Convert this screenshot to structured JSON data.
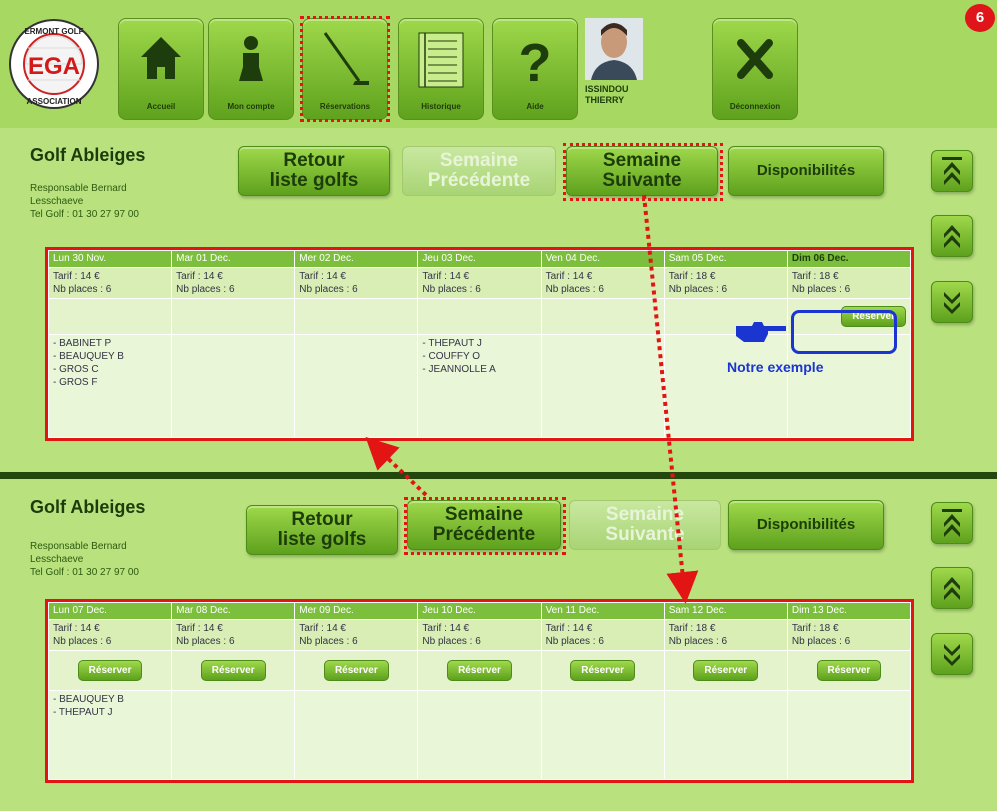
{
  "brand": {
    "logo_text": "EGA",
    "ring_text": "ERMONT GOLF ASSOCIATION"
  },
  "nav": {
    "items": [
      {
        "label": "Accueil",
        "icon": "home-icon"
      },
      {
        "label": "Mon compte",
        "icon": "person-icon"
      },
      {
        "label": "Réservations",
        "icon": "golf-club-icon"
      },
      {
        "label": "Historique",
        "icon": "list-icon"
      },
      {
        "label": "Aide",
        "icon": "question-icon"
      },
      {
        "label": "Déconnexion",
        "icon": "close-icon"
      }
    ],
    "user_line1": "ISSINDOU",
    "user_line2": "THIERRY",
    "badge": "6"
  },
  "golf": {
    "name": "Golf Ableiges",
    "responsable": "Responsable Bernard Lesschaeve",
    "tel": "Tel Golf : 01 30 27 97 00"
  },
  "buttons": {
    "retour_line1": "Retour",
    "retour_line2": "liste golfs",
    "prev_line1": "Semaine",
    "prev_line2": "Précédente",
    "next_line1": "Semaine",
    "next_line2": "Suivante",
    "dispo": "Disponibilités",
    "reserver": "Réserver"
  },
  "annotation": {
    "exemple": "Notre exemple"
  },
  "week1": {
    "days": [
      {
        "day": "Lun 30 Nov.",
        "tarif": "Tarif : 14 €",
        "places": "Nb places : 6",
        "reserver": false,
        "names": [
          "- BABINET P",
          "- BEAUQUEY B",
          "- GROS C",
          "- GROS F"
        ]
      },
      {
        "day": "Mar 01 Dec.",
        "tarif": "Tarif : 14 €",
        "places": "Nb places : 6",
        "reserver": false,
        "names": []
      },
      {
        "day": "Mer 02 Dec.",
        "tarif": "Tarif : 14 €",
        "places": "Nb places : 6",
        "reserver": false,
        "names": []
      },
      {
        "day": "Jeu 03 Dec.",
        "tarif": "Tarif : 14 €",
        "places": "Nb places : 6",
        "reserver": false,
        "names": [
          "- THEPAUT J",
          "- COUFFY O",
          "- JEANNOLLE A"
        ]
      },
      {
        "day": "Ven 04 Dec.",
        "tarif": "Tarif : 14 €",
        "places": "Nb places : 6",
        "reserver": false,
        "names": []
      },
      {
        "day": "Sam 05 Dec.",
        "tarif": "Tarif : 18 €",
        "places": "Nb places : 6",
        "reserver": false,
        "names": []
      },
      {
        "day": "Dim 06 Dec.",
        "tarif": "Tarif : 18 €",
        "places": "Nb places : 6",
        "reserver": true,
        "names": []
      }
    ]
  },
  "week2": {
    "days": [
      {
        "day": "Lun 07 Dec.",
        "tarif": "Tarif : 14 €",
        "places": "Nb places : 6",
        "reserver": true,
        "names": [
          "- BEAUQUEY B",
          "- THEPAUT J"
        ]
      },
      {
        "day": "Mar 08 Dec.",
        "tarif": "Tarif : 14 €",
        "places": "Nb places : 6",
        "reserver": true,
        "names": []
      },
      {
        "day": "Mer 09 Dec.",
        "tarif": "Tarif : 14 €",
        "places": "Nb places : 6",
        "reserver": true,
        "names": []
      },
      {
        "day": "Jeu 10 Dec.",
        "tarif": "Tarif : 14 €",
        "places": "Nb places : 6",
        "reserver": true,
        "names": []
      },
      {
        "day": "Ven 11 Dec.",
        "tarif": "Tarif : 14 €",
        "places": "Nb places : 6",
        "reserver": true,
        "names": []
      },
      {
        "day": "Sam 12 Dec.",
        "tarif": "Tarif : 18 €",
        "places": "Nb places : 6",
        "reserver": true,
        "names": []
      },
      {
        "day": "Dim 13 Dec.",
        "tarif": "Tarif : 18 €",
        "places": "Nb places : 6",
        "reserver": true,
        "names": []
      }
    ]
  },
  "colors": {
    "accent_red": "#e31414",
    "accent_blue": "#1a35d0",
    "button_green": "#6fb52a",
    "dark_green": "#23470d"
  }
}
